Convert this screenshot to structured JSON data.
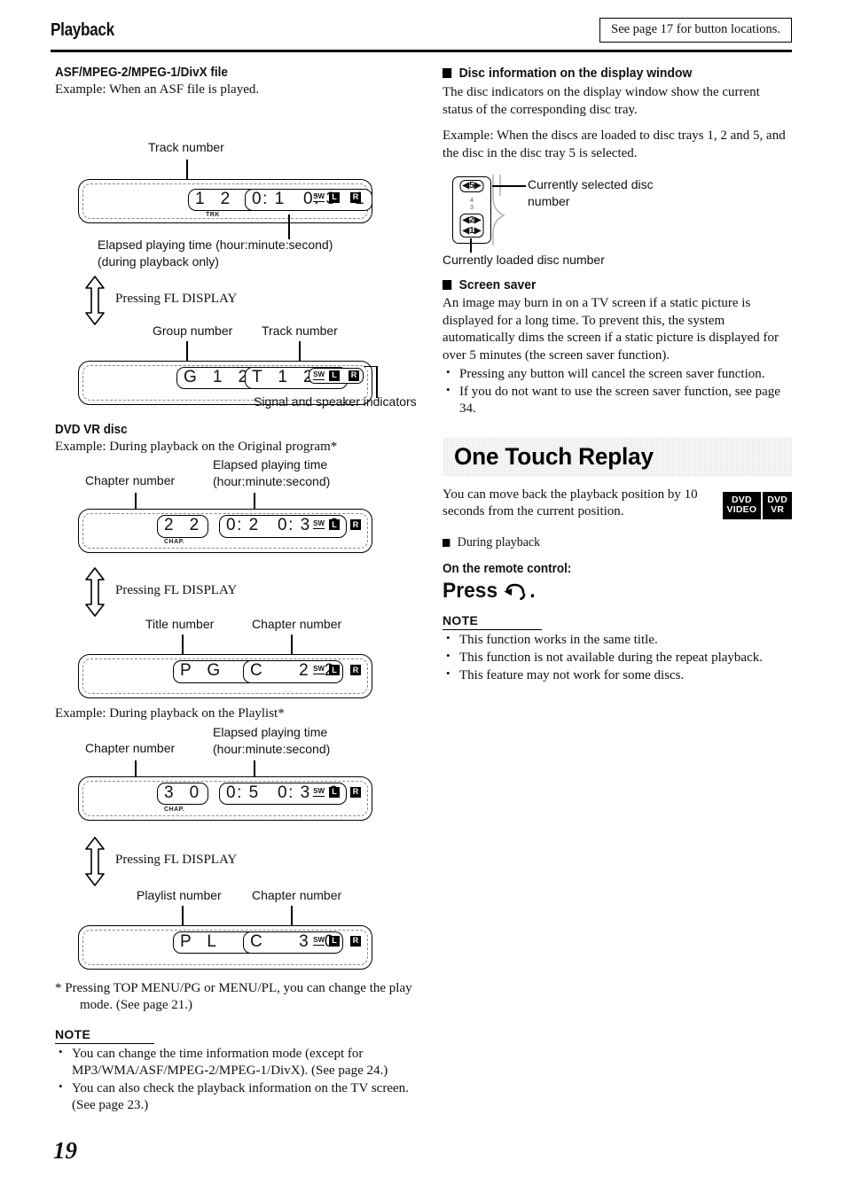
{
  "header": {
    "title": "Playback",
    "note_box": "See page 17 for button locations."
  },
  "left_column": {
    "section1": {
      "heading": "ASF/MPEG-2/MPEG-1/DivX file",
      "example": "Example: When an ASF file is played.",
      "callout_track_number": "Track number",
      "display1": {
        "field1": "1  2  3.",
        "field1_sublabel": "TRK",
        "field2": "0: 1   0: 3   1",
        "indicators": [
          "SW",
          "L",
          "R"
        ]
      },
      "callout_elapsed_line1": "Elapsed playing time (hour:minute:second)",
      "callout_elapsed_line2": "(during playback only)",
      "toggle_label": "Pressing FL DISPLAY",
      "callout_group_number": "Group number",
      "callout_track_number2": "Track number",
      "display2": {
        "field1": "G  1  2",
        "field2": "T  1  2  3",
        "indicators": [
          "SW",
          "L",
          "R"
        ]
      },
      "callout_signal": "Signal and speaker indicators"
    },
    "section2": {
      "heading": "DVD VR disc",
      "example": "Example: During playback on the Original program*",
      "callout_chapter_number": "Chapter number",
      "callout_elapsed_line1": "Elapsed playing time",
      "callout_elapsed_line2": "(hour:minute:second)",
      "display1": {
        "field1": "2  2",
        "field1_sublabel": "CHAP.",
        "field2": "0: 2   0: 3   6",
        "indicators": [
          "SW",
          "L",
          "R"
        ]
      },
      "toggle_label": "Pressing FL DISPLAY",
      "callout_title_number": "Title number",
      "callout_chapter_number2": "Chapter number",
      "display2": {
        "field1": "P  G    1.",
        "field2": "C     2  2",
        "indicators": [
          "SW",
          "L",
          "R"
        ]
      }
    },
    "section3": {
      "example": "Example: During playback on the Playlist*",
      "callout_chapter_number": "Chapter number",
      "callout_elapsed_line1": "Elapsed playing time",
      "callout_elapsed_line2": "(hour:minute:second)",
      "display1": {
        "field1": "3  0",
        "field1_sublabel": "CHAP.",
        "field2": "0: 5   0: 3   0",
        "indicators": [
          "SW",
          "L",
          "R"
        ]
      },
      "toggle_label": "Pressing FL DISPLAY",
      "callout_playlist_number": "Playlist number",
      "callout_chapter_number2": "Chapter number",
      "display2": {
        "field1": "P  L    1.",
        "field2": "C     3  0",
        "indicators": [
          "SW",
          "L",
          "R"
        ]
      }
    },
    "footnote": "*   Pressing TOP MENU/PG or MENU/PL, you can change the play mode. (See page 21.)",
    "note": {
      "heading": "NOTE",
      "items": [
        "You can change the time information mode (except for MP3/WMA/ASF/MPEG-2/MPEG-1/DivX). (See page 24.)",
        "You can also check the playback information on the TV screen. (See page 23.)"
      ]
    }
  },
  "right_column": {
    "disc_info": {
      "heading": "Disc information on the display window",
      "para1": "The disc indicators on the display window show the current status of the corresponding disc tray.",
      "para2": "Example: When the discs are loaded to disc trays 1, 2 and 5, and the disc in the disc tray 5 is selected.",
      "diagram": {
        "selected_disc": "5",
        "dim_discs": [
          "4",
          "3"
        ],
        "loaded_discs": [
          "2",
          "1"
        ],
        "callout_selected_line1": "Currently selected disc",
        "callout_selected_line2": "number",
        "callout_loaded": "Currently loaded disc number"
      }
    },
    "screen_saver": {
      "heading": "Screen saver",
      "para": "An image may burn in on a TV screen if a static picture is displayed for a long time. To prevent this, the system automatically dims the screen if a static picture is displayed for over 5 minutes (the screen saver function).",
      "items": [
        "Pressing any button will cancel the screen saver function.",
        "If you do not want to use the screen saver function, see page 34."
      ]
    },
    "one_touch_replay": {
      "banner_title": "One Touch Replay",
      "para": "You can move back the playback position by 10 seconds from the current position.",
      "badges": [
        {
          "line1": "DVD",
          "line2": "VIDEO"
        },
        {
          "line1": "DVD",
          "line2": "VR"
        }
      ],
      "during_playback": "During playback",
      "on_remote": "On the remote control:",
      "press_label": "Press",
      "press_suffix": ".",
      "press_icon": "replay-arrow-icon",
      "note": {
        "heading": "NOTE",
        "items": [
          "This function works in the same title.",
          "This function is not available during the repeat playback.",
          "This feature may not work for some discs."
        ]
      }
    }
  },
  "footer": {
    "page_number": "19"
  }
}
